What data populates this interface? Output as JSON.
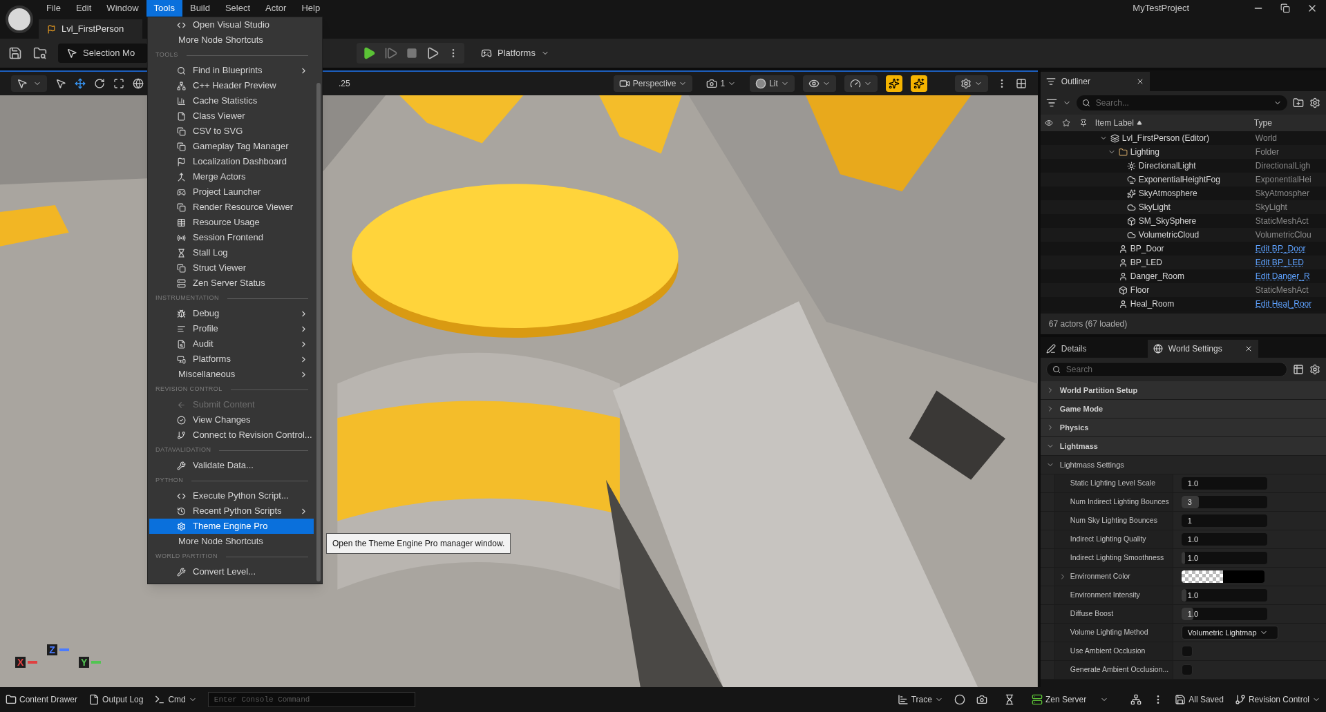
{
  "window": {
    "title": "MyTestProject"
  },
  "menubar": [
    {
      "label": "File",
      "selected": false
    },
    {
      "label": "Edit",
      "selected": false
    },
    {
      "label": "Window",
      "selected": false
    },
    {
      "label": "Tools",
      "selected": true
    },
    {
      "label": "Build",
      "selected": false
    },
    {
      "label": "Select",
      "selected": false
    },
    {
      "label": "Actor",
      "selected": false
    },
    {
      "label": "Help",
      "selected": false
    }
  ],
  "level_tab": {
    "label": "Lvl_FirstPerson"
  },
  "toolbar": {
    "selection_mode": "Selection Mo",
    "platforms": "Platforms"
  },
  "tools_menu": {
    "sections": [
      {
        "items": [
          {
            "label": "Open Visual Studio",
            "kind": "tool",
            "submenu": false,
            "disabled": false,
            "selected": false
          },
          {
            "label": "More Node Shortcuts",
            "kind": "plain",
            "submenu": false,
            "disabled": false,
            "selected": false
          }
        ]
      },
      {
        "heading": "TOOLS",
        "items": [
          {
            "label": "Find in Blueprints",
            "kind": "tool",
            "submenu": true,
            "disabled": false,
            "selected": false
          },
          {
            "label": "C++ Header Preview",
            "kind": "tool",
            "submenu": false,
            "disabled": false,
            "selected": false
          },
          {
            "label": "Cache Statistics",
            "kind": "tool",
            "submenu": false,
            "disabled": false,
            "selected": false
          },
          {
            "label": "Class Viewer",
            "kind": "tool",
            "submenu": false,
            "disabled": false,
            "selected": false
          },
          {
            "label": "CSV to SVG",
            "kind": "tool",
            "submenu": false,
            "disabled": false,
            "selected": false
          },
          {
            "label": "Gameplay Tag Manager",
            "kind": "tool",
            "submenu": false,
            "disabled": false,
            "selected": false
          },
          {
            "label": "Localization Dashboard",
            "kind": "tool",
            "submenu": false,
            "disabled": false,
            "selected": false
          },
          {
            "label": "Merge Actors",
            "kind": "tool",
            "submenu": false,
            "disabled": false,
            "selected": false
          },
          {
            "label": "Project Launcher",
            "kind": "tool",
            "submenu": false,
            "disabled": false,
            "selected": false
          },
          {
            "label": "Render Resource Viewer",
            "kind": "tool",
            "submenu": false,
            "disabled": false,
            "selected": false
          },
          {
            "label": "Resource Usage",
            "kind": "tool",
            "submenu": false,
            "disabled": false,
            "selected": false
          },
          {
            "label": "Session Frontend",
            "kind": "tool",
            "submenu": false,
            "disabled": false,
            "selected": false
          },
          {
            "label": "Stall Log",
            "kind": "tool",
            "submenu": false,
            "disabled": false,
            "selected": false
          },
          {
            "label": "Struct Viewer",
            "kind": "tool",
            "submenu": false,
            "disabled": false,
            "selected": false
          },
          {
            "label": "Zen Server Status",
            "kind": "tool",
            "submenu": false,
            "disabled": false,
            "selected": false
          }
        ]
      },
      {
        "heading": "INSTRUMENTATION",
        "items": [
          {
            "label": "Debug",
            "kind": "tool",
            "submenu": true,
            "disabled": false,
            "selected": false
          },
          {
            "label": "Profile",
            "kind": "tool",
            "submenu": true,
            "disabled": false,
            "selected": false
          },
          {
            "label": "Audit",
            "kind": "tool",
            "submenu": true,
            "disabled": false,
            "selected": false
          },
          {
            "label": "Platforms",
            "kind": "tool",
            "submenu": true,
            "disabled": false,
            "selected": false
          },
          {
            "label": "Miscellaneous",
            "kind": "plain",
            "submenu": true,
            "disabled": false,
            "selected": false
          }
        ]
      },
      {
        "heading": "REVISION CONTROL",
        "items": [
          {
            "label": "Submit Content",
            "kind": "tool",
            "submenu": false,
            "disabled": true,
            "selected": false
          },
          {
            "label": "View Changes",
            "kind": "tool",
            "submenu": false,
            "disabled": false,
            "selected": false
          },
          {
            "label": "Connect to Revision Control...",
            "kind": "tool",
            "submenu": false,
            "disabled": false,
            "selected": false
          }
        ]
      },
      {
        "heading": "DATAVALIDATION",
        "items": [
          {
            "label": "Validate Data...",
            "kind": "tool",
            "submenu": false,
            "disabled": false,
            "selected": false
          }
        ]
      },
      {
        "heading": "PYTHON",
        "items": [
          {
            "label": "Execute Python Script...",
            "kind": "tool",
            "submenu": false,
            "disabled": false,
            "selected": false
          },
          {
            "label": "Recent Python Scripts",
            "kind": "tool",
            "submenu": true,
            "disabled": false,
            "selected": false
          },
          {
            "label": "Theme Engine Pro",
            "kind": "tool",
            "submenu": false,
            "disabled": false,
            "selected": true
          },
          {
            "label": "More Node Shortcuts",
            "kind": "plain",
            "submenu": false,
            "disabled": false,
            "selected": false
          }
        ]
      },
      {
        "heading": "WORLD PARTITION",
        "items": [
          {
            "label": "Convert Level...",
            "kind": "tool",
            "submenu": false,
            "disabled": false,
            "selected": false
          }
        ]
      }
    ]
  },
  "tooltip": {
    "text": "Open the Theme Engine Pro manager window."
  },
  "viewport_toolbar": {
    "snap": ".25",
    "view": "Perspective",
    "camera_speed": "1",
    "view_mode": "Lit"
  },
  "axis_labels": [
    {
      "label": "X",
      "color": "#e04040"
    },
    {
      "label": "Z",
      "color": "#4a7bff"
    },
    {
      "label": "Y",
      "color": "#52c452"
    }
  ],
  "outliner": {
    "title": "Outliner",
    "search": {
      "placeholder": "Search..."
    },
    "columns": [
      "Item Label",
      "Type"
    ],
    "rows": [
      {
        "label": "Lvl_FirstPerson (Editor)",
        "type": "World",
        "kind": "plain",
        "expanded": true,
        "children": [
          {
            "label": "Lighting",
            "type": "Folder",
            "kind": "plain",
            "expanded": true,
            "children": [
              {
                "label": "DirectionalLight",
                "type": "DirectionalLigh",
                "kind": "plain"
              },
              {
                "label": "ExponentialHeightFog",
                "type": "ExponentialHei",
                "kind": "plain"
              },
              {
                "label": "SkyAtmosphere",
                "type": "SkyAtmospher",
                "kind": "plain"
              },
              {
                "label": "SkyLight",
                "type": "SkyLight",
                "kind": "plain"
              },
              {
                "label": "SM_SkySphere",
                "type": "StaticMeshAct",
                "kind": "plain"
              },
              {
                "label": "VolumetricCloud",
                "type": "VolumetricClou",
                "kind": "plain"
              }
            ]
          },
          {
            "label": "BP_Door",
            "type": "Edit BP_Door",
            "kind": "link"
          },
          {
            "label": "BP_LED",
            "type": "Edit BP_LED",
            "kind": "link"
          },
          {
            "label": "Danger_Room",
            "type": "Edit Danger_R",
            "kind": "link"
          },
          {
            "label": "Floor",
            "type": "StaticMeshAct",
            "kind": "plain"
          },
          {
            "label": "Heal_Room",
            "type": "Edit Heal_Roor",
            "kind": "link"
          }
        ]
      }
    ],
    "footer": "67 actors (67 loaded)"
  },
  "details": {
    "tabs": [
      {
        "label": "Details",
        "selected": false
      },
      {
        "label": "World Settings",
        "selected": true
      }
    ],
    "search": {
      "placeholder": "Search"
    },
    "categories": [
      {
        "label": "World Partition Setup",
        "expanded": false
      },
      {
        "label": "Game Mode",
        "expanded": false
      },
      {
        "label": "Physics",
        "expanded": false
      },
      {
        "label": "Lightmass",
        "expanded": true
      }
    ],
    "subcategory": {
      "label": "Lightmass Settings",
      "expanded": true
    },
    "properties": [
      {
        "label": "Static Lighting Level Scale",
        "kind": "number",
        "value": "1.0"
      },
      {
        "label": "Num Indirect Lighting Bounces",
        "kind": "number",
        "value": "3",
        "level": 0.2
      },
      {
        "label": "Num Sky Lighting Bounces",
        "kind": "number",
        "value": "1"
      },
      {
        "label": "Indirect Lighting Quality",
        "kind": "number",
        "value": "1.0"
      },
      {
        "label": "Indirect Lighting Smoothness",
        "kind": "number",
        "value": "1.0",
        "level": 0.04
      },
      {
        "label": "Environment Color",
        "kind": "color",
        "expanded": false
      },
      {
        "label": "Environment Intensity",
        "kind": "number",
        "value": "1.0",
        "level": 0.06
      },
      {
        "label": "Diffuse Boost",
        "kind": "number",
        "value": "1.0",
        "level": 0.14
      },
      {
        "label": "Volume Lighting Method",
        "kind": "dropdown",
        "value": "Volumetric Lightmap"
      },
      {
        "label": "Use Ambient Occlusion",
        "kind": "checkbox",
        "checked": false
      },
      {
        "label": "Generate Ambient Occlusion...",
        "kind": "checkbox",
        "checked": false
      }
    ]
  },
  "status_bar": {
    "content_drawer": "Content Drawer",
    "output_log": "Output Log",
    "cmd": "Cmd",
    "console": {
      "placeholder": "Enter Console Command"
    },
    "trace": "Trace",
    "zen_server": "Zen Server",
    "saved": "All Saved",
    "revision_control": "Revision Control"
  }
}
